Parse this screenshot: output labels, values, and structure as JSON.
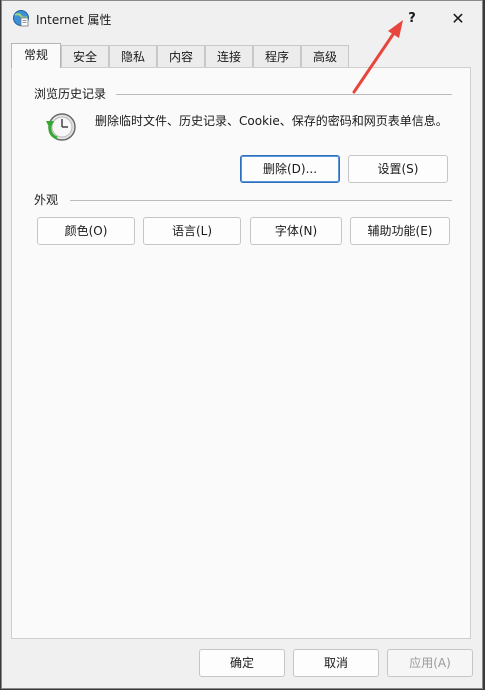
{
  "window": {
    "title": "Internet 属性",
    "help_label": "?",
    "close_label": "✕"
  },
  "tabs": [
    {
      "label": "常规",
      "active": true
    },
    {
      "label": "安全",
      "active": false
    },
    {
      "label": "隐私",
      "active": false
    },
    {
      "label": "内容",
      "active": false
    },
    {
      "label": "连接",
      "active": false
    },
    {
      "label": "程序",
      "active": false
    },
    {
      "label": "高级",
      "active": false
    }
  ],
  "history": {
    "title": "浏览历史记录",
    "description": "删除临时文件、历史记录、Cookie、保存的密码和网页表单信息。",
    "delete_label": "删除(D)...",
    "settings_label": "设置(S)"
  },
  "appearance": {
    "title": "外观",
    "colors_label": "颜色(O)",
    "languages_label": "语言(L)",
    "fonts_label": "字体(N)",
    "accessibility_label": "辅助功能(E)"
  },
  "footer": {
    "ok_label": "确定",
    "cancel_label": "取消",
    "apply_label": "应用(A)"
  },
  "colors": {
    "accent": "#2c6fbf",
    "arrow": "#e8453c"
  }
}
